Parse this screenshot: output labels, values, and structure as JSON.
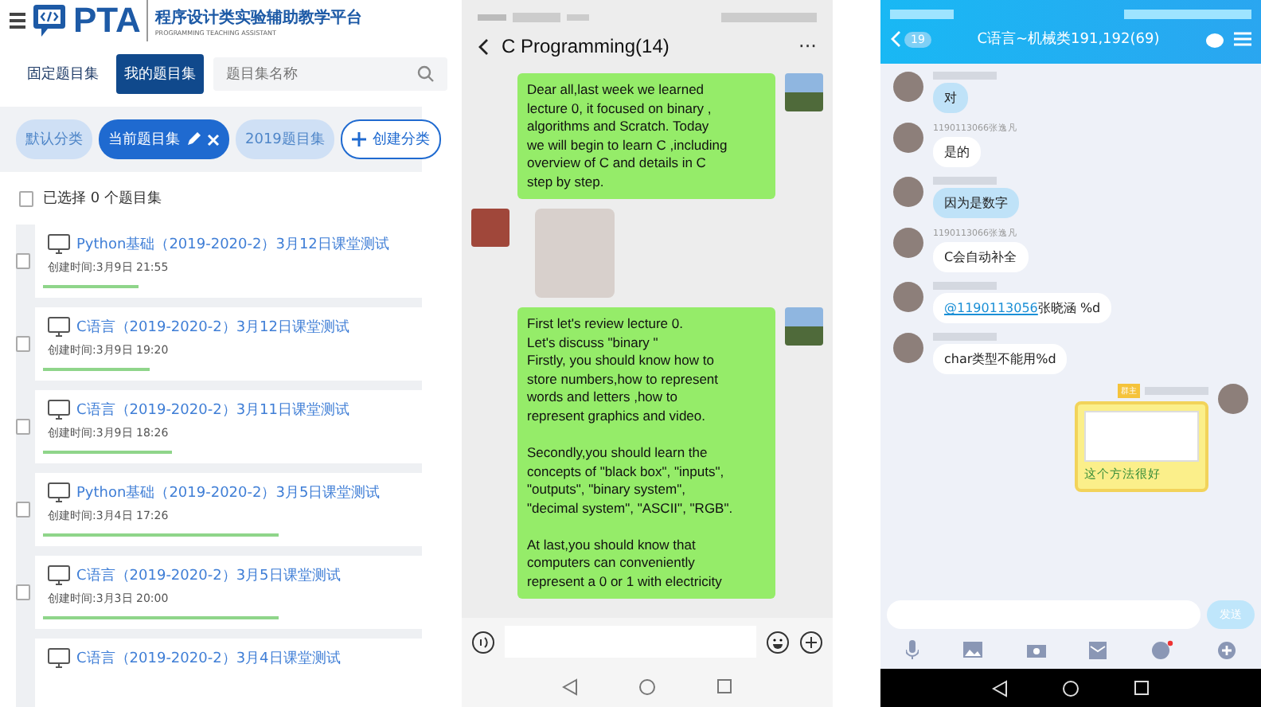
{
  "pta": {
    "logo": "PTA",
    "platform_title": "程序设计类实验辅助教学平台",
    "platform_subtitle": "PROGRAMMING TEACHING ASSISTANT",
    "tabs": [
      {
        "label": "固定题目集",
        "selected": false
      },
      {
        "label": "我的题目集",
        "selected": true
      }
    ],
    "search": {
      "placeholder": "题目集名称"
    },
    "chips": [
      {
        "label": "默认分类",
        "kind": "category",
        "selected": false
      },
      {
        "label": "当前题目集",
        "kind": "category",
        "selected": true
      },
      {
        "label": "2019题目集",
        "kind": "category",
        "selected": false
      },
      {
        "label": "创建分类",
        "kind": "add"
      }
    ],
    "selection": {
      "checked": false,
      "text": "已选择 0 个题目集"
    },
    "items": [
      {
        "checked": false,
        "title": "Python基础（2019-2020-2）3月12日课堂测试",
        "created": "创建时间:3月9日 21:55",
        "level": 0.25
      },
      {
        "checked": false,
        "title": "C语言（2019-2020-2）3月12日课堂测试",
        "created": "创建时间:3月9日 19:20",
        "level": 0.28
      },
      {
        "checked": false,
        "title": "C语言（2019-2020-2）3月11日课堂测试",
        "created": "创建时间:3月9日 18:26",
        "level": 0.34
      },
      {
        "checked": false,
        "title": "Python基础（2019-2020-2）3月5日课堂测试",
        "created": "创建时间:3月4日 17:26",
        "level": 0.62
      },
      {
        "checked": false,
        "title": "C语言（2019-2020-2）3月5日课堂测试",
        "created": "创建时间:3月3日 20:00",
        "level": 0.62
      },
      {
        "title": "C语言（2019-2020-2）3月4日课堂测试"
      }
    ]
  },
  "wechat": {
    "title": "C Programming(14)",
    "more": "···",
    "messages": [
      {
        "kind": "text",
        "outgoing": true,
        "text": "Dear all,last  week  we  learned\n lecture 0, it focused on  binary ,\nalgorithms and Scratch.  Today\nwe will begin to learn C ,including\noverview of  C   and  details  in C\nstep by step."
      },
      {
        "kind": "sticker",
        "outgoing": false
      },
      {
        "kind": "text",
        "outgoing": true,
        "text": "First let's review  lecture 0.\nLet's discuss \"binary \"\nFirstly, you should know how to\nstore numbers,how to represent\nwords and letters ,how to\nrepresent graphics and video.\n\nSecondly,you should learn the\nconcepts of \"black box\", \"inputs\",\n\"outputs\", \"binary  system\",\n\"decimal  system\", \"ASCII\",  \"RGB\".\n\nAt last,you should know that\ncomputers can conveniently\nrepresent a 0 or 1 with electricity"
      }
    ]
  },
  "qq": {
    "back_count": "19",
    "title": "C语言~机械类191,192(69)",
    "send_button": "发送",
    "messages": [
      {
        "kind": "bubble",
        "text": "对"
      },
      {
        "kind": "plain",
        "sender": "1190113066张逸凡",
        "text": "是的"
      },
      {
        "kind": "bubble",
        "text": "因为是数字"
      },
      {
        "kind": "plain",
        "sender": "1190113066张逸凡",
        "text": "C会自动补全"
      },
      {
        "kind": "mention",
        "mention": "@1190113056",
        "text": "张晓涵 %d"
      },
      {
        "kind": "plain",
        "text": "char类型不能用%d"
      },
      {
        "kind": "image",
        "badge": "群主",
        "text": "这个方法很好"
      }
    ]
  }
}
